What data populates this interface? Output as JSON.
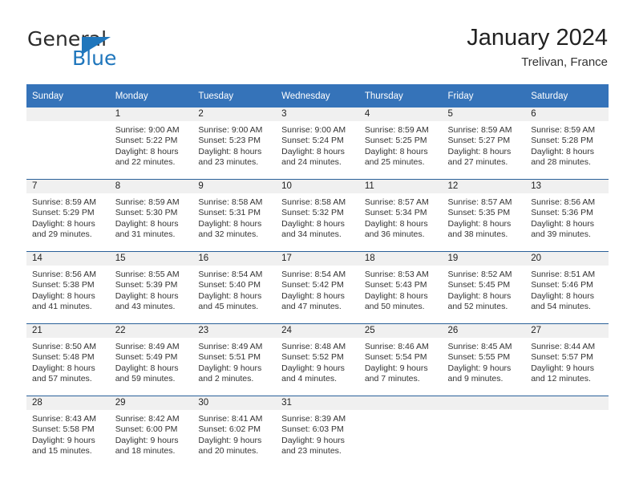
{
  "brand": {
    "word_one": "General",
    "word_two": "Blue",
    "logo_icon": "blue-triangle-logo"
  },
  "header": {
    "title": "January 2024",
    "location": "Trelivan, France"
  },
  "calendar": {
    "weekday_headers": [
      "Sunday",
      "Monday",
      "Tuesday",
      "Wednesday",
      "Thursday",
      "Friday",
      "Saturday"
    ],
    "labels": {
      "sunrise_prefix": "Sunrise:",
      "sunset_prefix": "Sunset:",
      "daylight_prefix": "Daylight:"
    },
    "colors": {
      "header_background": "#3573b9",
      "header_text": "#ffffff",
      "row_divider": "#2a6099",
      "daynum_background": "#f0f0f0",
      "brand_blue": "#1f76bc"
    },
    "weeks": [
      [
        {
          "day": "",
          "blank": true,
          "sunrise": "",
          "sunset": "",
          "daylight_line1": "",
          "daylight_line2": ""
        },
        {
          "day": "1",
          "sunrise": "Sunrise: 9:00 AM",
          "sunset": "Sunset: 5:22 PM",
          "daylight_line1": "Daylight: 8 hours",
          "daylight_line2": "and 22 minutes."
        },
        {
          "day": "2",
          "sunrise": "Sunrise: 9:00 AM",
          "sunset": "Sunset: 5:23 PM",
          "daylight_line1": "Daylight: 8 hours",
          "daylight_line2": "and 23 minutes."
        },
        {
          "day": "3",
          "sunrise": "Sunrise: 9:00 AM",
          "sunset": "Sunset: 5:24 PM",
          "daylight_line1": "Daylight: 8 hours",
          "daylight_line2": "and 24 minutes."
        },
        {
          "day": "4",
          "sunrise": "Sunrise: 8:59 AM",
          "sunset": "Sunset: 5:25 PM",
          "daylight_line1": "Daylight: 8 hours",
          "daylight_line2": "and 25 minutes."
        },
        {
          "day": "5",
          "sunrise": "Sunrise: 8:59 AM",
          "sunset": "Sunset: 5:27 PM",
          "daylight_line1": "Daylight: 8 hours",
          "daylight_line2": "and 27 minutes."
        },
        {
          "day": "6",
          "sunrise": "Sunrise: 8:59 AM",
          "sunset": "Sunset: 5:28 PM",
          "daylight_line1": "Daylight: 8 hours",
          "daylight_line2": "and 28 minutes."
        }
      ],
      [
        {
          "day": "7",
          "sunrise": "Sunrise: 8:59 AM",
          "sunset": "Sunset: 5:29 PM",
          "daylight_line1": "Daylight: 8 hours",
          "daylight_line2": "and 29 minutes."
        },
        {
          "day": "8",
          "sunrise": "Sunrise: 8:59 AM",
          "sunset": "Sunset: 5:30 PM",
          "daylight_line1": "Daylight: 8 hours",
          "daylight_line2": "and 31 minutes."
        },
        {
          "day": "9",
          "sunrise": "Sunrise: 8:58 AM",
          "sunset": "Sunset: 5:31 PM",
          "daylight_line1": "Daylight: 8 hours",
          "daylight_line2": "and 32 minutes."
        },
        {
          "day": "10",
          "sunrise": "Sunrise: 8:58 AM",
          "sunset": "Sunset: 5:32 PM",
          "daylight_line1": "Daylight: 8 hours",
          "daylight_line2": "and 34 minutes."
        },
        {
          "day": "11",
          "sunrise": "Sunrise: 8:57 AM",
          "sunset": "Sunset: 5:34 PM",
          "daylight_line1": "Daylight: 8 hours",
          "daylight_line2": "and 36 minutes."
        },
        {
          "day": "12",
          "sunrise": "Sunrise: 8:57 AM",
          "sunset": "Sunset: 5:35 PM",
          "daylight_line1": "Daylight: 8 hours",
          "daylight_line2": "and 38 minutes."
        },
        {
          "day": "13",
          "sunrise": "Sunrise: 8:56 AM",
          "sunset": "Sunset: 5:36 PM",
          "daylight_line1": "Daylight: 8 hours",
          "daylight_line2": "and 39 minutes."
        }
      ],
      [
        {
          "day": "14",
          "sunrise": "Sunrise: 8:56 AM",
          "sunset": "Sunset: 5:38 PM",
          "daylight_line1": "Daylight: 8 hours",
          "daylight_line2": "and 41 minutes."
        },
        {
          "day": "15",
          "sunrise": "Sunrise: 8:55 AM",
          "sunset": "Sunset: 5:39 PM",
          "daylight_line1": "Daylight: 8 hours",
          "daylight_line2": "and 43 minutes."
        },
        {
          "day": "16",
          "sunrise": "Sunrise: 8:54 AM",
          "sunset": "Sunset: 5:40 PM",
          "daylight_line1": "Daylight: 8 hours",
          "daylight_line2": "and 45 minutes."
        },
        {
          "day": "17",
          "sunrise": "Sunrise: 8:54 AM",
          "sunset": "Sunset: 5:42 PM",
          "daylight_line1": "Daylight: 8 hours",
          "daylight_line2": "and 47 minutes."
        },
        {
          "day": "18",
          "sunrise": "Sunrise: 8:53 AM",
          "sunset": "Sunset: 5:43 PM",
          "daylight_line1": "Daylight: 8 hours",
          "daylight_line2": "and 50 minutes."
        },
        {
          "day": "19",
          "sunrise": "Sunrise: 8:52 AM",
          "sunset": "Sunset: 5:45 PM",
          "daylight_line1": "Daylight: 8 hours",
          "daylight_line2": "and 52 minutes."
        },
        {
          "day": "20",
          "sunrise": "Sunrise: 8:51 AM",
          "sunset": "Sunset: 5:46 PM",
          "daylight_line1": "Daylight: 8 hours",
          "daylight_line2": "and 54 minutes."
        }
      ],
      [
        {
          "day": "21",
          "sunrise": "Sunrise: 8:50 AM",
          "sunset": "Sunset: 5:48 PM",
          "daylight_line1": "Daylight: 8 hours",
          "daylight_line2": "and 57 minutes."
        },
        {
          "day": "22",
          "sunrise": "Sunrise: 8:49 AM",
          "sunset": "Sunset: 5:49 PM",
          "daylight_line1": "Daylight: 8 hours",
          "daylight_line2": "and 59 minutes."
        },
        {
          "day": "23",
          "sunrise": "Sunrise: 8:49 AM",
          "sunset": "Sunset: 5:51 PM",
          "daylight_line1": "Daylight: 9 hours",
          "daylight_line2": "and 2 minutes."
        },
        {
          "day": "24",
          "sunrise": "Sunrise: 8:48 AM",
          "sunset": "Sunset: 5:52 PM",
          "daylight_line1": "Daylight: 9 hours",
          "daylight_line2": "and 4 minutes."
        },
        {
          "day": "25",
          "sunrise": "Sunrise: 8:46 AM",
          "sunset": "Sunset: 5:54 PM",
          "daylight_line1": "Daylight: 9 hours",
          "daylight_line2": "and 7 minutes."
        },
        {
          "day": "26",
          "sunrise": "Sunrise: 8:45 AM",
          "sunset": "Sunset: 5:55 PM",
          "daylight_line1": "Daylight: 9 hours",
          "daylight_line2": "and 9 minutes."
        },
        {
          "day": "27",
          "sunrise": "Sunrise: 8:44 AM",
          "sunset": "Sunset: 5:57 PM",
          "daylight_line1": "Daylight: 9 hours",
          "daylight_line2": "and 12 minutes."
        }
      ],
      [
        {
          "day": "28",
          "sunrise": "Sunrise: 8:43 AM",
          "sunset": "Sunset: 5:58 PM",
          "daylight_line1": "Daylight: 9 hours",
          "daylight_line2": "and 15 minutes."
        },
        {
          "day": "29",
          "sunrise": "Sunrise: 8:42 AM",
          "sunset": "Sunset: 6:00 PM",
          "daylight_line1": "Daylight: 9 hours",
          "daylight_line2": "and 18 minutes."
        },
        {
          "day": "30",
          "sunrise": "Sunrise: 8:41 AM",
          "sunset": "Sunset: 6:02 PM",
          "daylight_line1": "Daylight: 9 hours",
          "daylight_line2": "and 20 minutes."
        },
        {
          "day": "31",
          "sunrise": "Sunrise: 8:39 AM",
          "sunset": "Sunset: 6:03 PM",
          "daylight_line1": "Daylight: 9 hours",
          "daylight_line2": "and 23 minutes."
        },
        {
          "day": "",
          "blank": true,
          "sunrise": "",
          "sunset": "",
          "daylight_line1": "",
          "daylight_line2": ""
        },
        {
          "day": "",
          "blank": true,
          "sunrise": "",
          "sunset": "",
          "daylight_line1": "",
          "daylight_line2": ""
        },
        {
          "day": "",
          "blank": true,
          "sunrise": "",
          "sunset": "",
          "daylight_line1": "",
          "daylight_line2": ""
        }
      ]
    ]
  }
}
